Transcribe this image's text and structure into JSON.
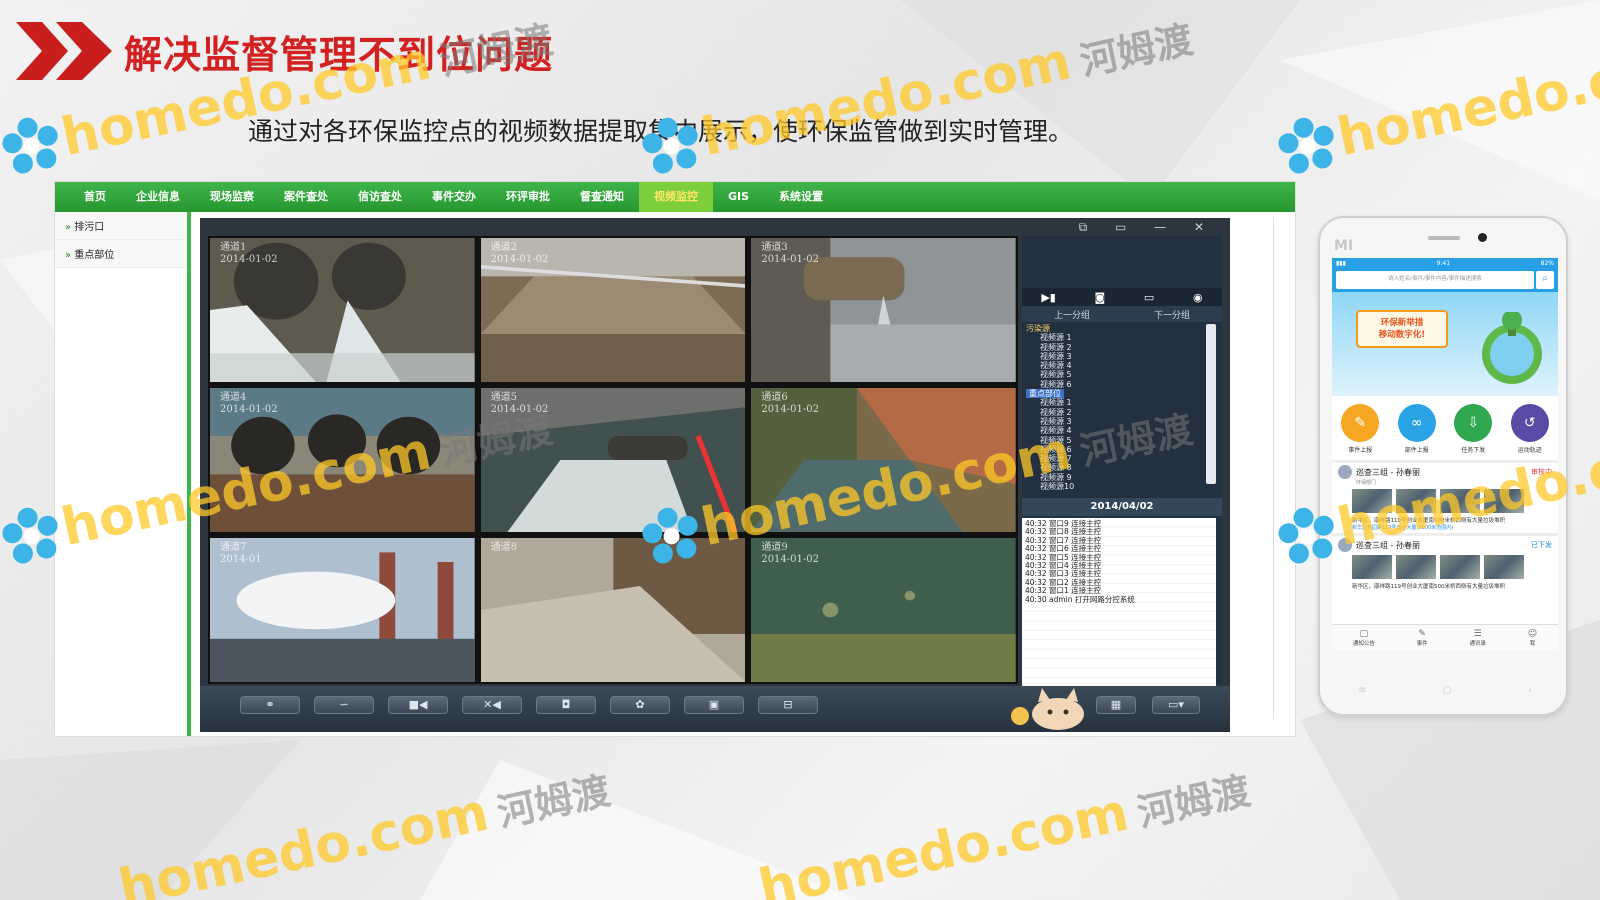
{
  "slide": {
    "title": "解决监督管理不到位问题",
    "subtitle": "通过对各环保监控点的视频数据提取集中展示，使环保监管做到实时管理。"
  },
  "watermark": {
    "text": "homedo.com",
    "cn": "河姆渡"
  },
  "app": {
    "nav": [
      "首页",
      "企业信息",
      "现场监察",
      "案件查处",
      "信访查处",
      "事件交办",
      "环评审批",
      "督查通知",
      "视频监控",
      "GIS",
      "系统设置"
    ],
    "active_nav": "视频监控",
    "sidebar": [
      "排污口",
      "重点部位"
    ],
    "window_controls": "⧉ ▭ — ✕",
    "channels": [
      {
        "name": "通道1",
        "date": "2014-01-02"
      },
      {
        "name": "通道2",
        "date": "2014-01-02"
      },
      {
        "name": "通道3",
        "date": "2014-01-02"
      },
      {
        "name": "通道4",
        "date": "2014-01-02"
      },
      {
        "name": "通道5",
        "date": "2014-01-02"
      },
      {
        "name": "通道6",
        "date": "2014-01-02"
      },
      {
        "name": "通道7",
        "date": "2014-01"
      },
      {
        "name": "通道8",
        "date": ""
      },
      {
        "name": "通道9",
        "date": "2014-01-02"
      }
    ],
    "panel": {
      "prev_group": "上一分组",
      "next_group": "下一分组",
      "groups": [
        {
          "name": "污染源",
          "selected": false,
          "children": [
            "视频源 1",
            "视频源 2",
            "视频源 3",
            "视频源 4",
            "视频源 5",
            "视频源 6"
          ]
        },
        {
          "name": "重点部位",
          "selected": true,
          "children": [
            "视频源 1",
            "视频源 2",
            "视频源 3",
            "视频源 4",
            "视频源 5",
            "视频源 6",
            "视频源 7",
            "视频源 8",
            "视频源 9",
            "视频源10"
          ]
        }
      ],
      "date": "2014/04/02",
      "log": [
        "40:32 窗口9 连接主控",
        "40:32 窗口8 连接主控",
        "40:32 窗口7 连接主控",
        "40:32 窗口6 连接主控",
        "40:32 窗口5 连接主控",
        "40:32 窗口4 连接主控",
        "40:32 窗口3 连接主控",
        "40:32 窗口2 连接主控",
        "40:32 窗口1 连接主控",
        "40:30 admin 打开网路分控系统"
      ]
    },
    "toolbar_icons": [
      "link-icon",
      "unlink-icon",
      "record-icon",
      "stop-record-icon",
      "camera-icon",
      "settings-icon",
      "screen-icon",
      "layout-icon",
      "grid-icon",
      "window-icon"
    ]
  },
  "phone": {
    "brand": "MI",
    "time": "9:41",
    "battery": "82%",
    "search_placeholder": "请入姓名/事件/事件内容/事件描述搜索",
    "banner_text": "环保新举措\n移动数字化!",
    "quick_actions": [
      {
        "label": "事件上报",
        "color": "#f5a623",
        "icon": "✎"
      },
      {
        "label": "部件上报",
        "color": "#2aa3e6",
        "icon": "∞"
      },
      {
        "label": "任务下发",
        "color": "#2fa84f",
        "icon": "⇩"
      },
      {
        "label": "运动轨迹",
        "color": "#5b4aa6",
        "icon": "↺"
      }
    ],
    "feed": [
      {
        "who": "巡查三组 - 孙春丽",
        "sub": "环保部门",
        "status": "审核中",
        "desc": "新华区，康祥路119号创业大厦南500米桥西侧有大量垃圾堆积",
        "loc": "新华区燕园路119号创业大厦(3000米范围内)"
      },
      {
        "who": "巡查三组 - 孙春丽",
        "sub": "",
        "status": "已下发",
        "desc": "新华区，康祥路119号创业大厦南500米桥西侧有大量垃圾堆积",
        "loc": ""
      }
    ],
    "tabs": [
      "通知公告",
      "事件",
      "通讯录",
      "我"
    ]
  }
}
